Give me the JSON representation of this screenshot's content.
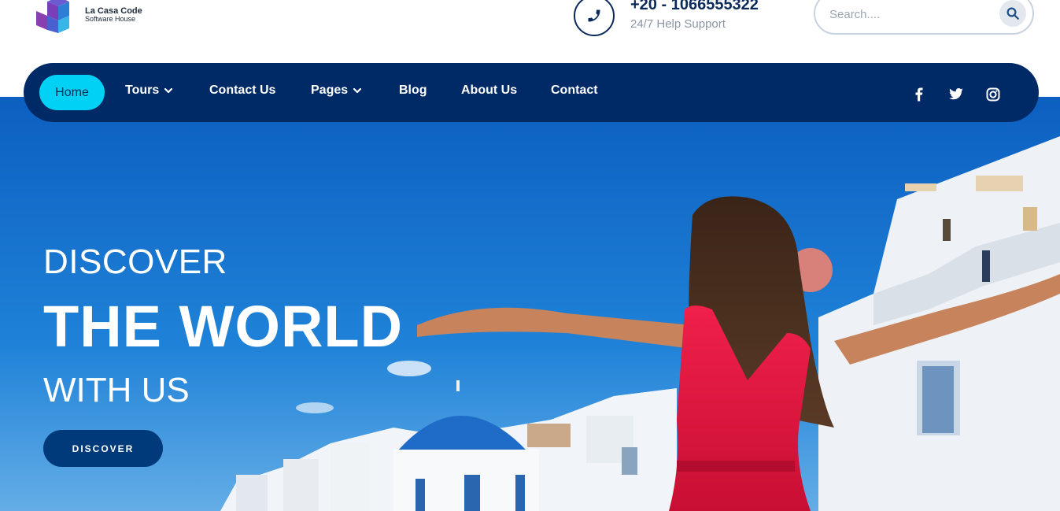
{
  "brand": {
    "name": "La Casa Code",
    "tagline": "Software House"
  },
  "contact": {
    "phone_icon": "phone-icon",
    "phone_number": "+20 - 1066555322",
    "support_text": "24/7 Help Support"
  },
  "search": {
    "placeholder": "Search....",
    "icon": "search-icon"
  },
  "nav": {
    "home": "Home",
    "tours": "Tours",
    "contact_us": "Contact Us",
    "pages": "Pages",
    "blog": "Blog",
    "about": "About Us",
    "contact": "Contact",
    "social_icons": [
      "facebook-icon",
      "twitter-icon",
      "instagram-icon"
    ]
  },
  "hero": {
    "line1": "DISCOVER",
    "line2": "THE WORLD",
    "line3": "WITH US",
    "button": "DISCOVER"
  },
  "colors": {
    "navy": "#002a66",
    "accent": "#00d1f5",
    "dress_red": "#e0133c",
    "sky": "#1a7ad6"
  }
}
